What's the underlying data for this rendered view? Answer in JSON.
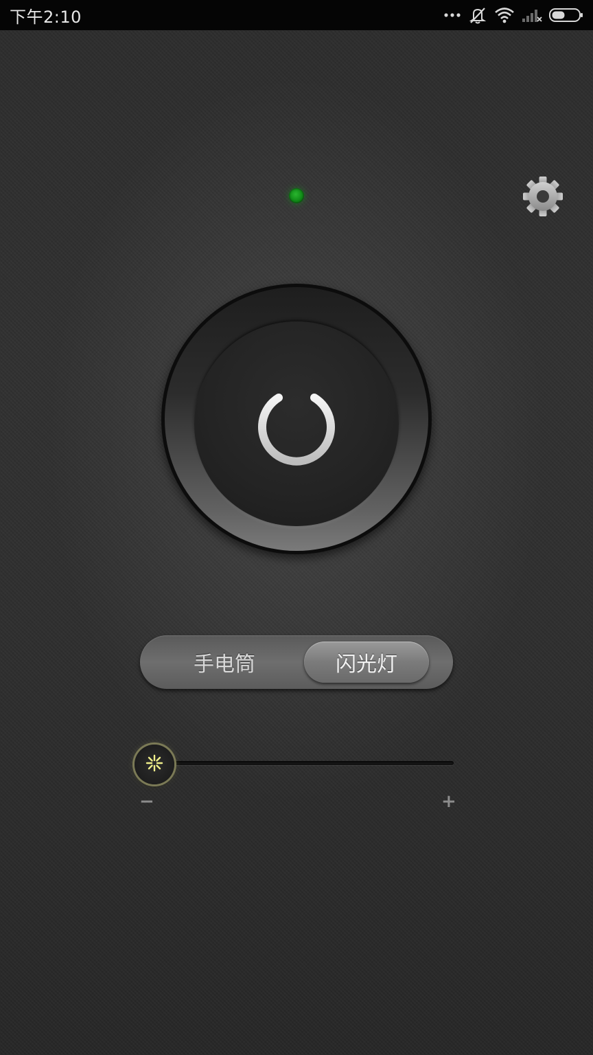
{
  "status_bar": {
    "time": "下午2:10",
    "icons": [
      "more-dots-icon",
      "silent-mode-icon",
      "wifi-icon",
      "signal-no-service-icon",
      "battery-icon"
    ]
  },
  "indicator": {
    "icon": "status-led-icon",
    "color": "#1a9e22"
  },
  "settings": {
    "icon": "gear-icon"
  },
  "power_button": {
    "icon": "power-icon"
  },
  "mode_switch": {
    "options": [
      "手电筒",
      "闪光灯"
    ],
    "selected": "闪光灯"
  },
  "slider": {
    "min_label": "−",
    "max_label": "+",
    "thumb_icon": "sparkle-icon",
    "value": 0
  },
  "colors": {
    "background": "#2e2e2e",
    "status_bar": "#050505",
    "led": "#1a9e22",
    "slider_glow": "#e8e870"
  }
}
